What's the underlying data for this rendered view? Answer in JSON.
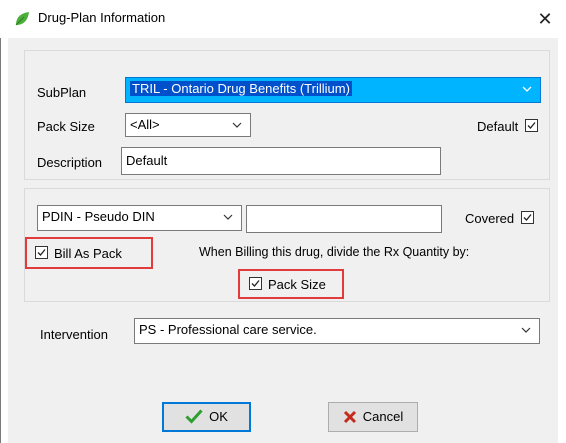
{
  "window": {
    "title": "Drug-Plan Information",
    "close_symbol": "✕"
  },
  "plan": {
    "subplan_label": "SubPlan",
    "subplan_value": "TRIL - Ontario Drug Benefits (Trillium)",
    "pack_size_label": "Pack Size",
    "pack_size_value": "<All>",
    "default_label": "Default",
    "default_checked": true,
    "description_label": "Description",
    "description_value": "Default"
  },
  "billing": {
    "din_type_value": "PDIN - Pseudo DIN",
    "din_value": "",
    "covered_label": "Covered",
    "covered_checked": true,
    "bill_as_pack_label": "Bill As Pack",
    "bill_as_pack_checked": true,
    "divide_instruction": "When Billing this drug, divide the Rx Quantity by:",
    "pack_size_option_label": "Pack Size",
    "pack_size_option_checked": true
  },
  "intervention": {
    "label": "Intervention",
    "value": "PS - Professional care service."
  },
  "buttons": {
    "ok_label": "OK",
    "cancel_label": "Cancel"
  },
  "colors": {
    "selection_blue": "#00b4ff",
    "selection_text_bg": "#0050cc",
    "highlight_red": "#e23b3b",
    "ok_check_green": "#2e9e2e",
    "cancel_x_red": "#c42b1c",
    "leaf_green": "#4caf3c"
  }
}
